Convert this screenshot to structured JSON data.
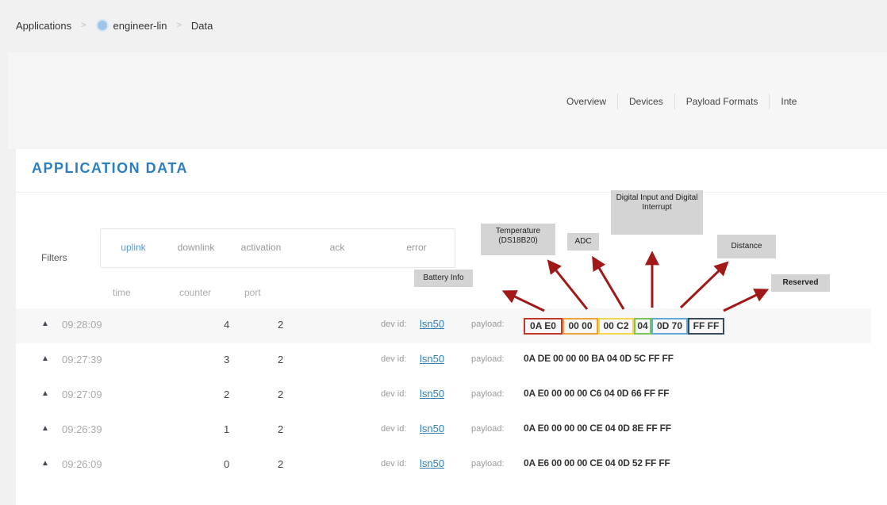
{
  "breadcrumb": {
    "root": "Applications",
    "app": "engineer-lin",
    "page": "Data"
  },
  "tabs": [
    "Overview",
    "Devices",
    "Payload Formats",
    "Inte"
  ],
  "title": "APPLICATION DATA",
  "filters": {
    "label": "Filters",
    "items": [
      "uplink",
      "downlink",
      "activation",
      "ack",
      "error"
    ],
    "active": "uplink"
  },
  "columns": {
    "time": "time",
    "counter": "counter",
    "port": "port"
  },
  "labels": {
    "devid": "dev id:",
    "payload": "payload:"
  },
  "rows": [
    {
      "time": "09:28:09",
      "counter": "4",
      "port": "2",
      "devid": "lsn50",
      "payload": "0A E0 00 00 00 C2 04 0D 70 FF FF"
    },
    {
      "time": "09:27:39",
      "counter": "3",
      "port": "2",
      "devid": "lsn50",
      "payload": "0A DE 00 00 00 BA 04 0D 5C FF FF"
    },
    {
      "time": "09:27:09",
      "counter": "2",
      "port": "2",
      "devid": "lsn50",
      "payload": "0A E0 00 00 00 C6 04 0D 66 FF FF"
    },
    {
      "time": "09:26:39",
      "counter": "1",
      "port": "2",
      "devid": "lsn50",
      "payload": "0A E0 00 00 00 CE 04 0D 8E FF FF"
    },
    {
      "time": "09:26:09",
      "counter": "0",
      "port": "2",
      "devid": "lsn50",
      "payload": "0A E6 00 00 00 CE 04 0D 52 FF FF"
    }
  ],
  "segments": [
    {
      "text": "0A E0",
      "color": "#c0392b"
    },
    {
      "text": "00 00",
      "color": "#e8a33c"
    },
    {
      "text": "00 C2",
      "color": "#f2d64b"
    },
    {
      "text": "04",
      "color": "#7dc35b"
    },
    {
      "text": "0D 70",
      "color": "#62a8d8"
    },
    {
      "text": "FF FF",
      "color": "#3a4a5a"
    }
  ],
  "annotations": {
    "battery": "Battery Info",
    "temperature": "Temperature (DS18B20)",
    "adc": "ADC",
    "digital": "Digital Input and Digital Interrupt",
    "distance": "Distance",
    "reserved": "Reserved"
  },
  "colors": {
    "accent": "#2e7fc2",
    "arrow": "#a01818"
  }
}
